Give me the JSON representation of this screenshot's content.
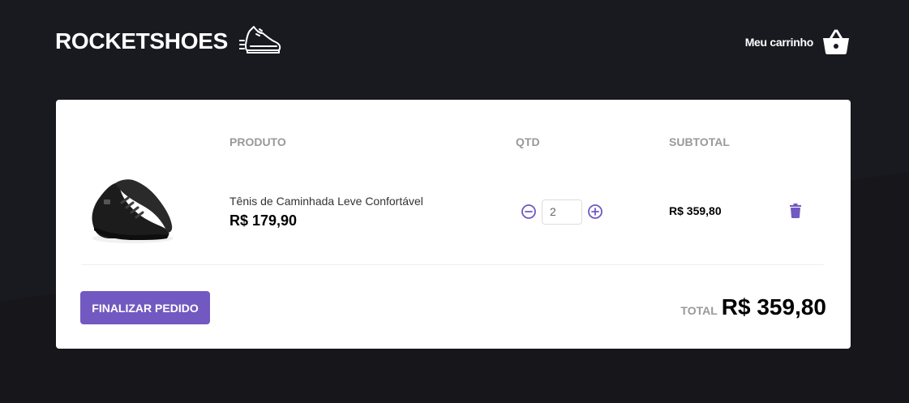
{
  "header": {
    "logo_text": "ROCKETSHOES",
    "logo_icon": "running-shoe-icon",
    "cart_label": "Meu carrinho",
    "cart_icon": "shopping-basket-icon"
  },
  "cart": {
    "columns": [
      "",
      "PRODUTO",
      "QTD",
      "SUBTOTAL",
      ""
    ],
    "items": [
      {
        "image": "black-sneaker-image",
        "title": "Tênis de Caminhada Leve Confortável",
        "price": "R$ 179,90",
        "quantity": "2",
        "subtotal": "R$ 359,80",
        "remove_icon": "trash-icon",
        "decrement_icon": "minus-circle-icon",
        "increment_icon": "plus-circle-icon"
      }
    ]
  },
  "footer": {
    "checkout_label": "Finalizar pedido",
    "total_label": "TOTAL",
    "total_value": "R$ 359,80"
  },
  "colors": {
    "background": "#191920",
    "accent": "#7159c1",
    "card": "#ffffff"
  }
}
